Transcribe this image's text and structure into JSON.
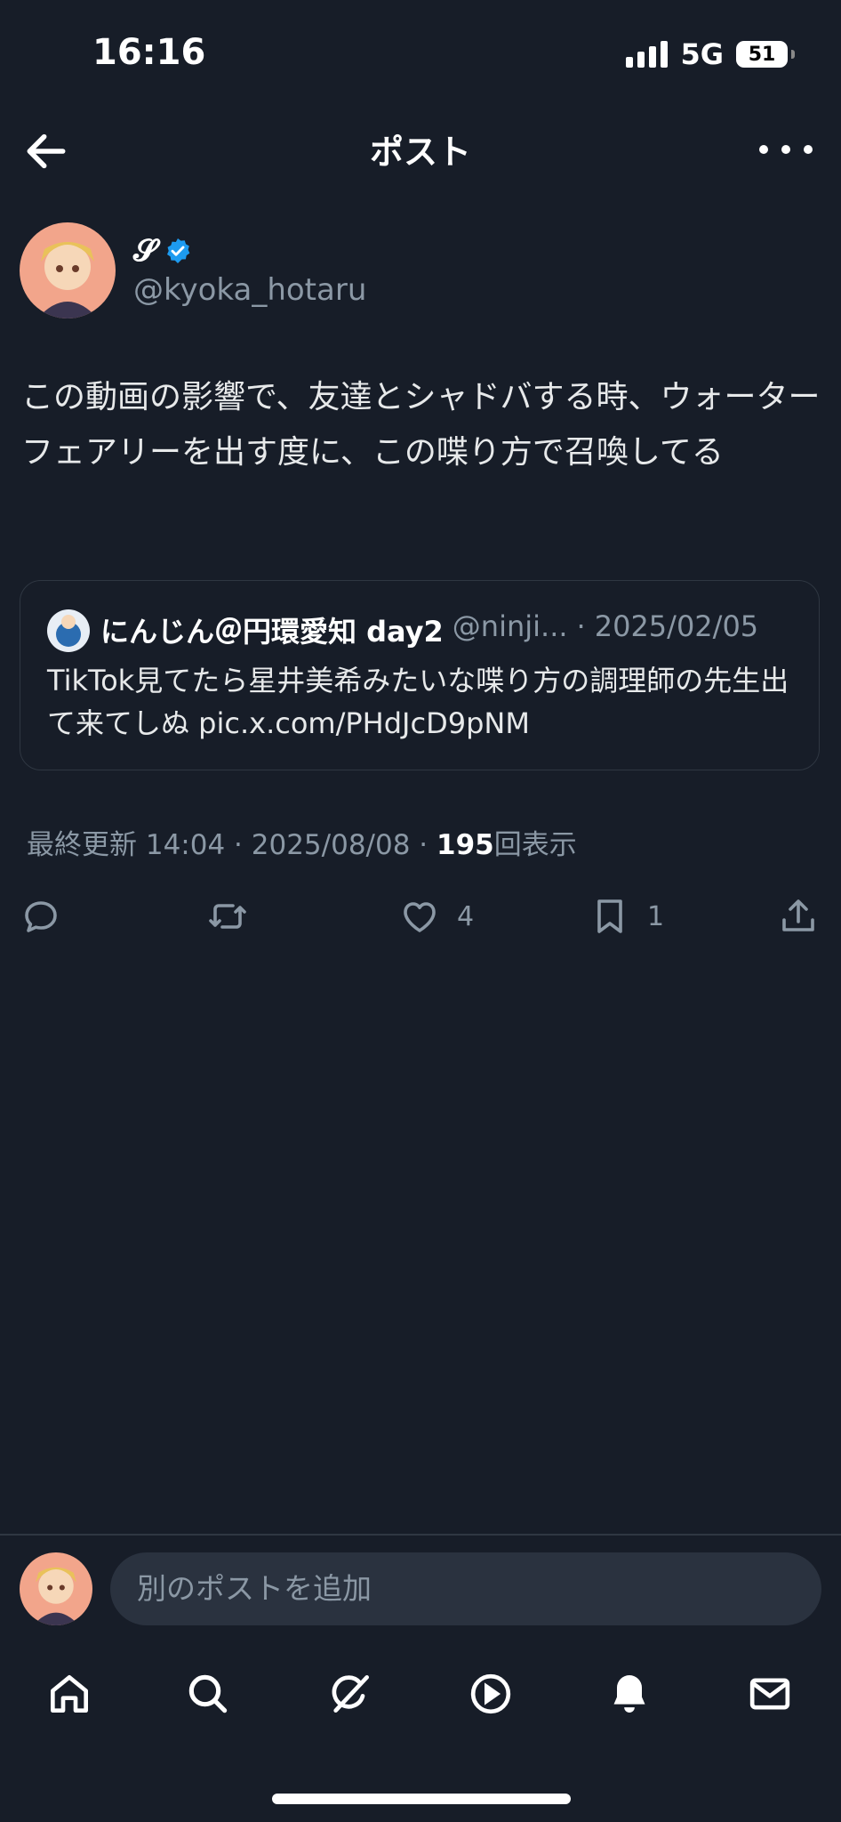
{
  "status_bar": {
    "time": "16:16",
    "network": "5G",
    "battery": "51"
  },
  "header": {
    "title": "ポスト",
    "back_icon": "back-arrow-icon",
    "more_icon": "more-icon"
  },
  "post": {
    "author_name": "𝓢",
    "handle": "@kyoka_hotaru",
    "text": "この動画の影響で、友達とシャドバする時、ウォーターフェアリーを出す度に、この喋り方で召喚してる",
    "quote": {
      "name": "にんじん＠円環愛知 day2",
      "handle": "@ninji...",
      "separator": "·",
      "date": "2025/02/05",
      "text": "TikTok見てたら星井美希みたいな喋り方の調理師の先生出て来てしぬ pic.x.com/PHdJcD9pNM"
    },
    "updated": "最終更新 14:04 · 2025/08/08",
    "dot": "·",
    "views": "195",
    "views_label": "回表示"
  },
  "actions": {
    "reply": "",
    "repost": "",
    "like": "4",
    "bookmark": "1"
  },
  "reply_bar": {
    "placeholder": "別のポストを追加"
  },
  "colors": {
    "background": "#171d28",
    "verified": "#1d9bf0",
    "muted": "#8b98a5",
    "accent": "#ffffff"
  }
}
